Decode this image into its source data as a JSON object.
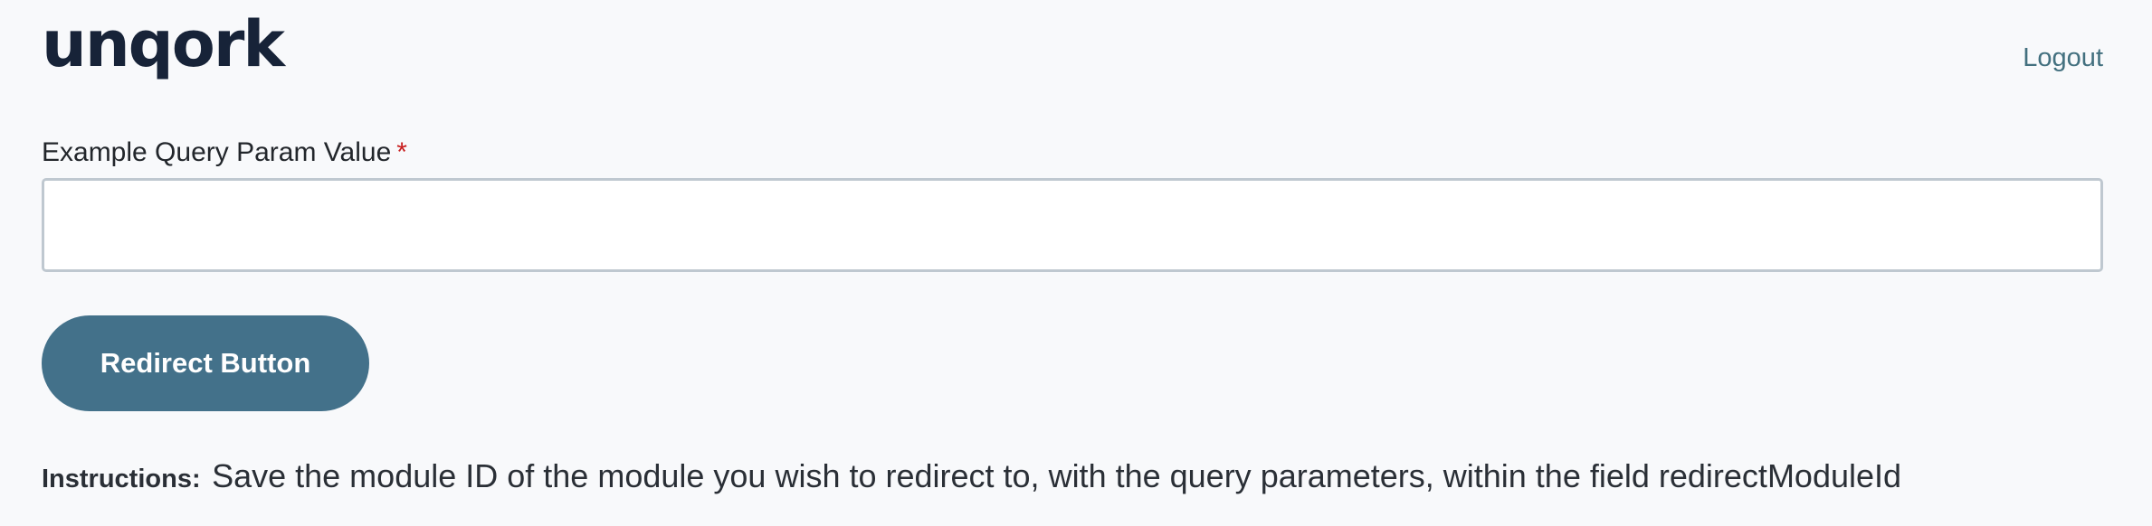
{
  "header": {
    "logo_text": "unqork",
    "logout_label": "Logout"
  },
  "form": {
    "field_label": "Example Query Param Value",
    "required_marker": "*",
    "field_value": "",
    "field_placeholder": "",
    "redirect_button_label": "Redirect Button"
  },
  "instructions": {
    "label": "Instructions:",
    "text": "Save the module ID of the module you wish to redirect to, with the query parameters, within the field redirectModuleId"
  },
  "colors": {
    "brand": "#172338",
    "accent": "#43718a",
    "link": "#43707f",
    "required": "#c81e1e"
  }
}
